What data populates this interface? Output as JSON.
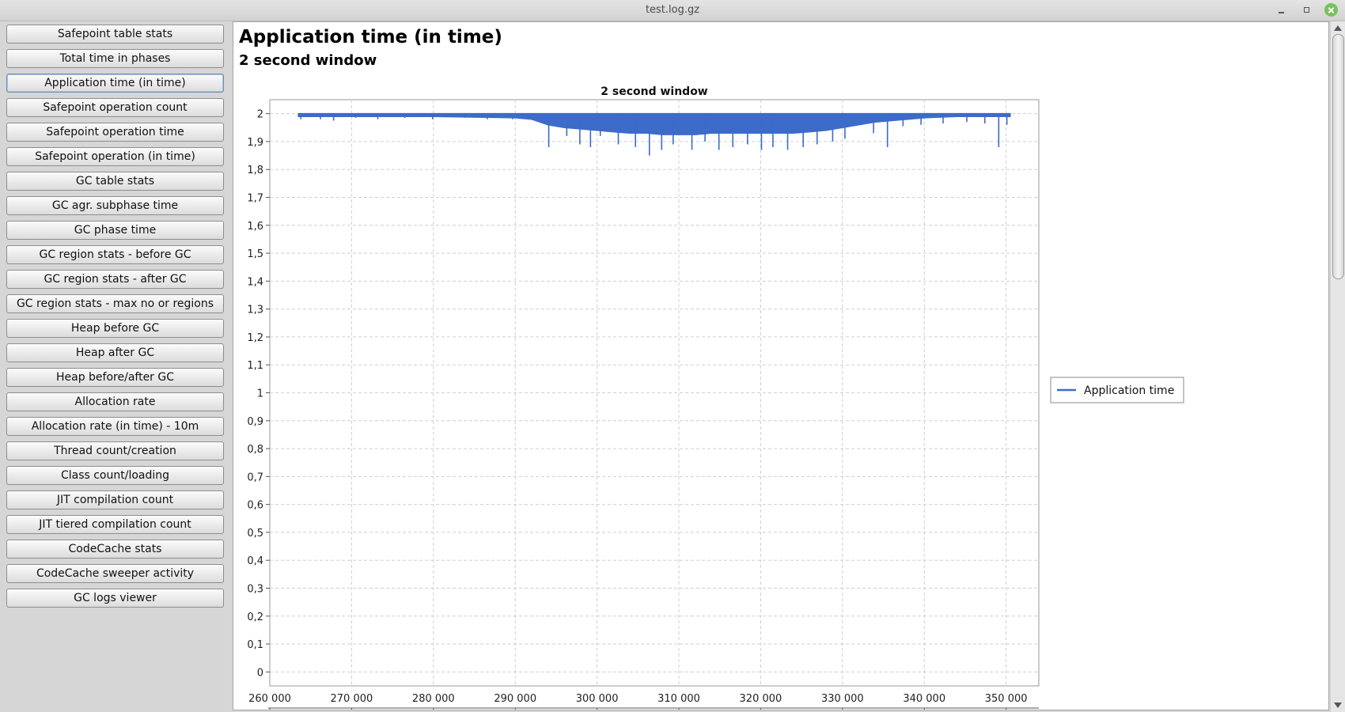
{
  "window": {
    "title": "test.log.gz"
  },
  "sidebar": {
    "items": [
      {
        "label": "Safepoint table stats",
        "active": false
      },
      {
        "label": "Total time in phases",
        "active": false
      },
      {
        "label": "Application time (in time)",
        "active": true
      },
      {
        "label": "Safepoint operation count",
        "active": false
      },
      {
        "label": "Safepoint operation time",
        "active": false
      },
      {
        "label": "Safepoint operation (in time)",
        "active": false
      },
      {
        "label": "GC table stats",
        "active": false
      },
      {
        "label": "GC agr. subphase time",
        "active": false
      },
      {
        "label": "GC phase time",
        "active": false
      },
      {
        "label": "GC region stats - before GC",
        "active": false
      },
      {
        "label": "GC region stats - after GC",
        "active": false
      },
      {
        "label": "GC region stats - max no or regions",
        "active": false
      },
      {
        "label": "Heap before GC",
        "active": false
      },
      {
        "label": "Heap after GC",
        "active": false
      },
      {
        "label": "Heap before/after GC",
        "active": false
      },
      {
        "label": "Allocation rate",
        "active": false
      },
      {
        "label": "Allocation rate (in time) - 10m",
        "active": false
      },
      {
        "label": "Thread count/creation",
        "active": false
      },
      {
        "label": "Class count/loading",
        "active": false
      },
      {
        "label": "JIT compilation count",
        "active": false
      },
      {
        "label": "JIT tiered compilation count",
        "active": false
      },
      {
        "label": "CodeCache stats",
        "active": false
      },
      {
        "label": "CodeCache sweeper activity",
        "active": false
      },
      {
        "label": "GC logs viewer",
        "active": false
      }
    ]
  },
  "main": {
    "title": "Application time (in time)",
    "subtitle": "2 second window"
  },
  "chart_data": {
    "type": "line",
    "title": "2 second window",
    "xlabel": "",
    "ylabel": "",
    "xlim": [
      260000,
      354000
    ],
    "ylim": [
      -0.05,
      2.05
    ],
    "x_ticks": [
      260000,
      270000,
      280000,
      290000,
      300000,
      310000,
      320000,
      330000,
      340000,
      350000
    ],
    "x_tick_labels": [
      "260 000",
      "270 000",
      "280 000",
      "290 000",
      "300 000",
      "310 000",
      "320 000",
      "330 000",
      "340 000",
      "350 000"
    ],
    "y_ticks": [
      0,
      0.1,
      0.2,
      0.3,
      0.4,
      0.5,
      0.6,
      0.7,
      0.8,
      0.9,
      1,
      1.1,
      1.2,
      1.3,
      1.4,
      1.5,
      1.6,
      1.7,
      1.8,
      1.9,
      2
    ],
    "y_tick_labels": [
      "0",
      "0,1",
      "0,2",
      "0,3",
      "0,4",
      "0,5",
      "0,6",
      "0,7",
      "0,8",
      "0,9",
      "1",
      "1,1",
      "1,2",
      "1,3",
      "1,4",
      "1,5",
      "1,6",
      "1,7",
      "1,8",
      "1,9",
      "2"
    ],
    "grid": true,
    "legend_position": "right",
    "series": [
      {
        "name": "Application time",
        "color": "#3c6bc8",
        "band": {
          "x": [
            263500,
            270000,
            280000,
            290000,
            292000,
            294000,
            296000,
            298000,
            300000,
            302000,
            304000,
            306000,
            308000,
            310000,
            312000,
            314000,
            316000,
            318000,
            320000,
            322000,
            324000,
            326000,
            328000,
            330000,
            332000,
            334000,
            336000,
            338000,
            340000,
            344000,
            348000,
            350500
          ],
          "upper": [
            2.0,
            2.0,
            2.0,
            2.0,
            2.0,
            2.0,
            2.0,
            2.0,
            2.0,
            2.0,
            2.0,
            2.0,
            2.0,
            2.0,
            2.0,
            2.0,
            2.0,
            2.0,
            2.0,
            2.0,
            2.0,
            2.0,
            2.0,
            2.0,
            2.0,
            2.0,
            2.0,
            2.0,
            2.0,
            2.0,
            2.0,
            2.0
          ],
          "lower": [
            1.99,
            1.99,
            1.99,
            1.985,
            1.98,
            1.96,
            1.95,
            1.945,
            1.94,
            1.935,
            1.93,
            1.93,
            1.925,
            1.925,
            1.925,
            1.93,
            1.93,
            1.93,
            1.93,
            1.93,
            1.93,
            1.935,
            1.94,
            1.95,
            1.96,
            1.97,
            1.975,
            1.98,
            1.985,
            1.99,
            1.99,
            1.99
          ]
        },
        "dips": [
          [
            263800,
            1.98
          ],
          [
            266200,
            1.98
          ],
          [
            267800,
            1.975
          ],
          [
            270500,
            1.985
          ],
          [
            273200,
            1.98
          ],
          [
            276500,
            1.985
          ],
          [
            279900,
            1.98
          ],
          [
            283800,
            1.985
          ],
          [
            286600,
            1.98
          ],
          [
            289700,
            1.98
          ],
          [
            294100,
            1.88
          ],
          [
            296300,
            1.92
          ],
          [
            297900,
            1.89
          ],
          [
            299200,
            1.88
          ],
          [
            300400,
            1.92
          ],
          [
            302600,
            1.89
          ],
          [
            304700,
            1.88
          ],
          [
            306400,
            1.85
          ],
          [
            307900,
            1.87
          ],
          [
            309300,
            1.89
          ],
          [
            311600,
            1.87
          ],
          [
            313200,
            1.9
          ],
          [
            314900,
            1.87
          ],
          [
            316600,
            1.88
          ],
          [
            318400,
            1.89
          ],
          [
            320100,
            1.87
          ],
          [
            321500,
            1.88
          ],
          [
            323300,
            1.87
          ],
          [
            325200,
            1.88
          ],
          [
            326900,
            1.89
          ],
          [
            328800,
            1.9
          ],
          [
            330300,
            1.91
          ],
          [
            333800,
            1.93
          ],
          [
            335500,
            1.88
          ],
          [
            337400,
            1.955
          ],
          [
            339600,
            1.96
          ],
          [
            342300,
            1.965
          ],
          [
            345200,
            1.97
          ],
          [
            347400,
            1.965
          ],
          [
            349100,
            1.88
          ],
          [
            350100,
            1.96
          ]
        ]
      }
    ]
  }
}
